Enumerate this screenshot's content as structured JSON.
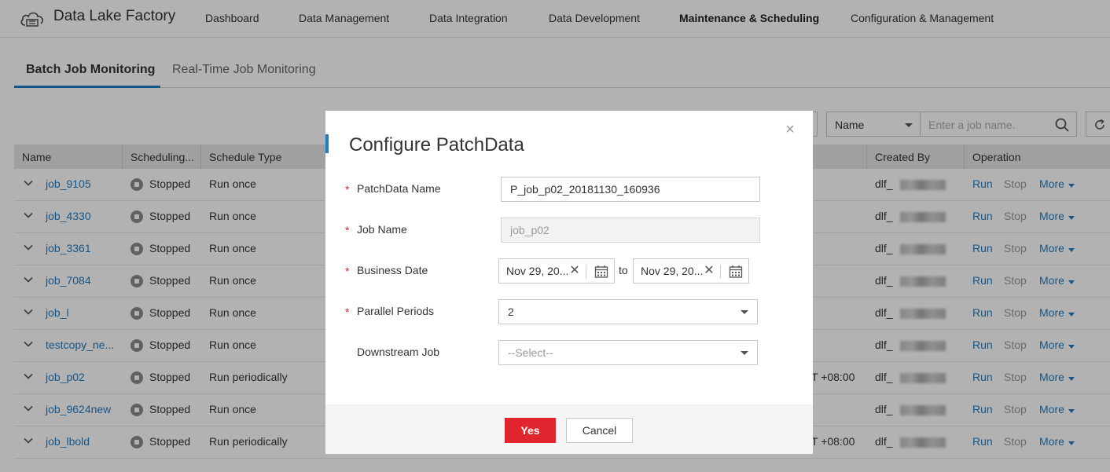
{
  "app": {
    "title": "Data Lake Factory",
    "logo_icon": "cloud-factory-icon"
  },
  "nav": {
    "items": [
      {
        "label": "Dashboard",
        "active": false
      },
      {
        "label": "Data Management",
        "active": false
      },
      {
        "label": "Data Integration",
        "active": false
      },
      {
        "label": "Data Development",
        "active": false
      },
      {
        "label": "Maintenance & Scheduling",
        "active": true
      },
      {
        "label": "Configuration & Management",
        "active": false
      }
    ]
  },
  "tabs": [
    {
      "label": "Batch Job Monitoring",
      "active": true
    },
    {
      "label": "Real-Time Job Monitoring",
      "active": false
    }
  ],
  "search": {
    "field_select": "Name",
    "placeholder": "Enter a job name."
  },
  "table": {
    "headers": [
      "Name",
      "Scheduling...",
      "Schedule Type",
      "Created By",
      "Operation"
    ],
    "rows": [
      {
        "name": "job_9105",
        "status": "Stopped",
        "schedule_type": "Run once",
        "extra": "",
        "created_by": "dlf_"
      },
      {
        "name": "job_4330",
        "status": "Stopped",
        "schedule_type": "Run once",
        "extra": "",
        "created_by": "dlf_"
      },
      {
        "name": "job_3361",
        "status": "Stopped",
        "schedule_type": "Run once",
        "extra": "",
        "created_by": "dlf_"
      },
      {
        "name": "job_7084",
        "status": "Stopped",
        "schedule_type": "Run once",
        "extra": "",
        "created_by": "dlf_"
      },
      {
        "name": "job_l",
        "status": "Stopped",
        "schedule_type": "Run once",
        "extra": "",
        "created_by": "dlf_"
      },
      {
        "name": "testcopy_ne...",
        "status": "Stopped",
        "schedule_type": "Run once",
        "extra": "",
        "created_by": "dlf_"
      },
      {
        "name": "job_p02",
        "status": "Stopped",
        "schedule_type": "Run periodically",
        "extra": "T +08:00",
        "created_by": "dlf_"
      },
      {
        "name": "job_9624new",
        "status": "Stopped",
        "schedule_type": "Run once",
        "extra": "",
        "created_by": "dlf_"
      },
      {
        "name": "job_lbold",
        "status": "Stopped",
        "schedule_type": "Run periodically",
        "extra": "T +08:00",
        "created_by": "dlf_"
      }
    ],
    "operations": {
      "run": "Run",
      "stop": "Stop",
      "more": "More"
    }
  },
  "modal": {
    "title": "Configure PatchData",
    "close_icon": "close-icon",
    "fields": {
      "patch_name": {
        "label": "PatchData Name",
        "value": "P_job_p02_20181130_160936",
        "required": true
      },
      "job_name": {
        "label": "Job Name",
        "value": "job_p02",
        "required": true
      },
      "business_date": {
        "label": "Business Date",
        "from": "Nov 29, 20...",
        "to_label": "to",
        "to": "Nov 29, 20...",
        "required": true
      },
      "parallel_periods": {
        "label": "Parallel Periods",
        "value": "2",
        "required": true
      },
      "downstream_job": {
        "label": "Downstream Job",
        "placeholder": "--Select--",
        "required": false
      }
    },
    "buttons": {
      "yes": "Yes",
      "cancel": "Cancel"
    },
    "required_mark": "*"
  },
  "colors": {
    "accent": "#1f7cc4",
    "primary_button": "#e0252e",
    "required": "#e0252e"
  }
}
